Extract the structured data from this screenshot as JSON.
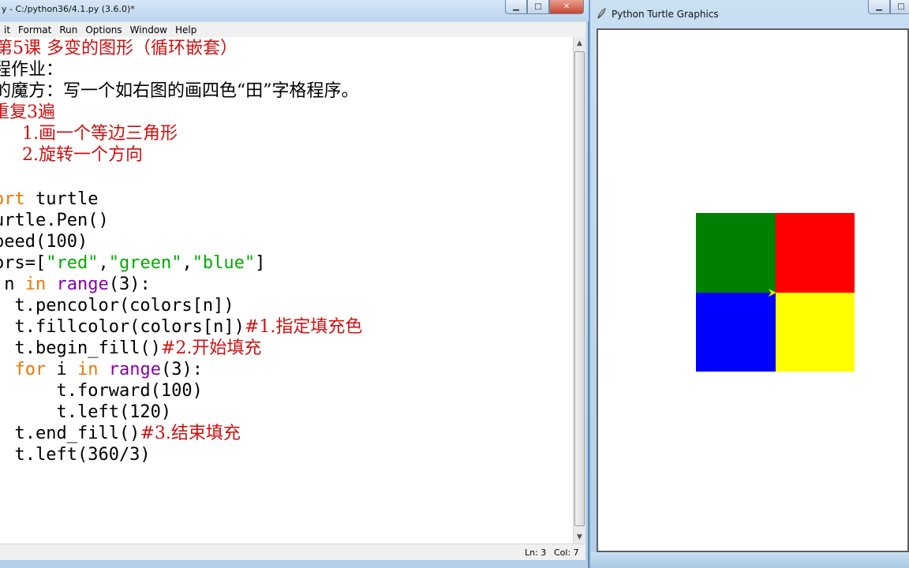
{
  "editor": {
    "title": "y - C:/python36/4.1.py (3.6.0)*",
    "menu": [
      "it",
      "Format",
      "Run",
      "Options",
      "Window",
      "Help"
    ],
    "status": {
      "ln": "Ln: 3",
      "col": "Col: 7"
    },
    "code": {
      "l1": "第5课 多变的图形（循环嵌套）",
      "l2": "程作业：",
      "l3": "的魔方：写一个如右图的画四色“田”字格程序。",
      "l4": "重复3遍",
      "l5": "    1.画一个等边三角形",
      "l6": "    2.旋转一个方向",
      "l8_kw": "ort",
      "l8_rest": " turtle",
      "l9": "urtle.Pen()",
      "l10": "peed(100)",
      "l11_a": "ors=[",
      "l11_s1": "\"red\"",
      "l11_c1": ",",
      "l11_s2": "\"green\"",
      "l11_c2": ",",
      "l11_s3": "\"blue\"",
      "l11_b": "]",
      "l12_a": " n ",
      "l12_kw": "in",
      "l12_sp": " ",
      "l12_bi": "range",
      "l12_b": "(3):",
      "l13": "  t.pencolor(colors[n])",
      "l14_a": "  t.fillcolor(colors[n])",
      "l14_c": "#1.指定填充色",
      "l15_a": "  t.begin_fill()",
      "l15_c": "#2.开始填充",
      "l16_sp": "  ",
      "l16_kw1": "for",
      "l16_a": " i ",
      "l16_kw2": "in",
      "l16_sp2": " ",
      "l16_bi": "range",
      "l16_b": "(3):",
      "l17": "      t.forward(100)",
      "l18": "      t.left(120)",
      "l19_a": "  t.end_fill()",
      "l19_c": "#3.结束填充",
      "l20": "  t.left(360/3)"
    }
  },
  "turtle_window": {
    "title": "Python Turtle Graphics",
    "squares": [
      {
        "name": "green-square",
        "color": "#008000"
      },
      {
        "name": "red-square",
        "color": "#ff0000"
      },
      {
        "name": "blue-square",
        "color": "#0000ff"
      },
      {
        "name": "yellow-square",
        "color": "#ffff00"
      }
    ],
    "cursor_color": "#e6e600"
  },
  "colors": {
    "red_text": "#cc1111",
    "keyword": "#ee7700",
    "builtin": "#8800aa",
    "string": "#00aa00"
  }
}
